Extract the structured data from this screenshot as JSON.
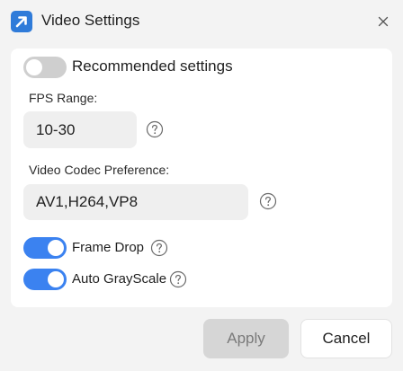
{
  "window": {
    "title": "Video Settings"
  },
  "recommended": {
    "label": "Recommended settings",
    "enabled": false
  },
  "fps": {
    "label": "FPS Range:",
    "value": "10-30"
  },
  "codec": {
    "label": "Video Codec Preference:",
    "value": "AV1,H264,VP8"
  },
  "frame_drop": {
    "label": "Frame Drop",
    "enabled": true
  },
  "auto_grayscale": {
    "label": "Auto GrayScale",
    "enabled": true
  },
  "buttons": {
    "apply": "Apply",
    "cancel": "Cancel"
  },
  "colors": {
    "accent": "#3b82f0",
    "toggle_off": "#cfcfcf",
    "app_icon": "#2f7bd9"
  },
  "icons": {
    "app": "arrow-up-right-icon",
    "close": "close-icon",
    "help": "help-icon"
  }
}
